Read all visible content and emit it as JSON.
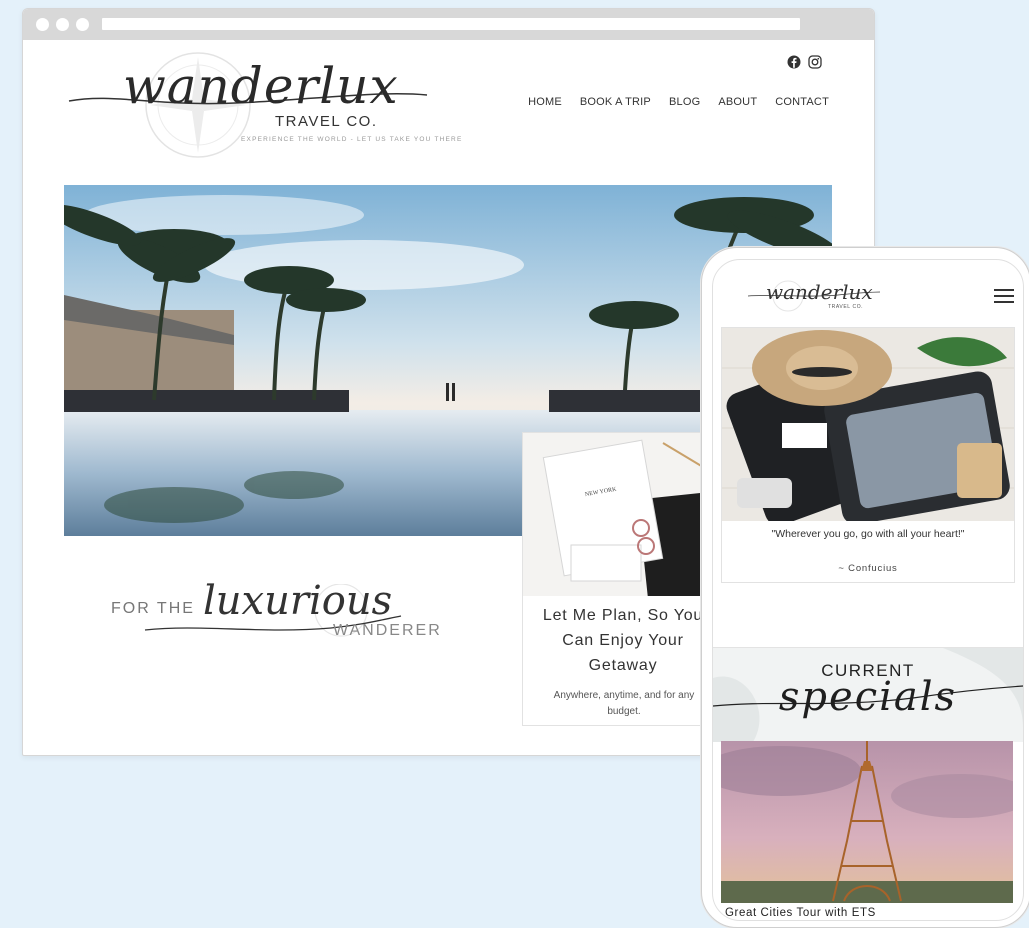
{
  "browser": {
    "nav": [
      "HOME",
      "BOOK A TRIP",
      "BLOG",
      "ABOUT",
      "CONTACT"
    ]
  },
  "logo": {
    "script": "wanderlux",
    "sub": "TRAVEL CO.",
    "tagline": "EXPERIENCE THE WORLD - LET US TAKE YOU THERE"
  },
  "social": {
    "icons": [
      "facebook-icon",
      "instagram-icon"
    ]
  },
  "tagline": {
    "for_the": "FOR THE",
    "script": "luxurious",
    "wanderer": "WANDERER"
  },
  "card": {
    "title_lines": [
      "Let Me Plan, So You",
      "Can Enjoy Your",
      "Getaway"
    ],
    "text": "Anywhere, anytime, and for any budget.",
    "notebook_text": "NEW YORK"
  },
  "mobile": {
    "logo_script": "wanderlux",
    "logo_sub": "TRAVEL CO.",
    "quote": "\"Wherever you go, go with all your heart!\"",
    "author": "~ Confucius",
    "specials_current": "CURRENT",
    "specials_script": "specials",
    "tour_title": "Great Cities Tour with ETS"
  },
  "colors": {
    "page_background": "#e4f1fa",
    "browser_bar": "#d8d8d8",
    "text_dark": "#333333"
  }
}
